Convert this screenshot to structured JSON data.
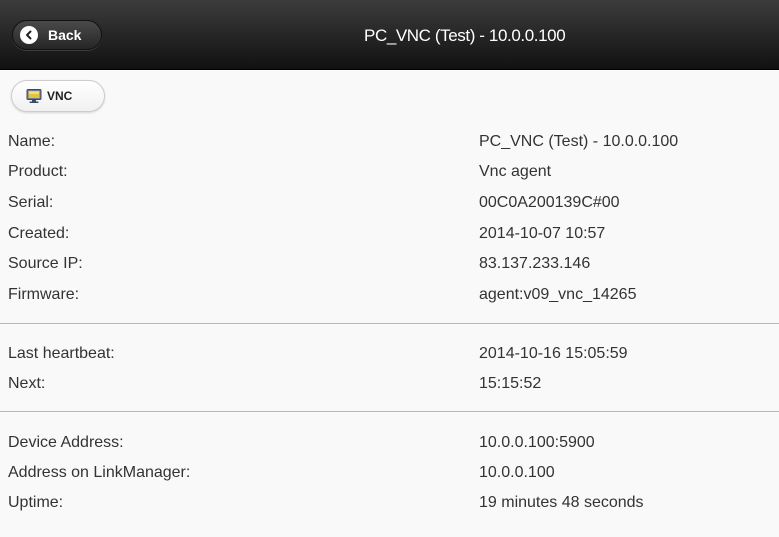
{
  "header": {
    "back_label": "Back",
    "title": "PC_VNC (Test) - 10.0.0.100"
  },
  "toolbar": {
    "vnc_label": "VNC"
  },
  "colors": {
    "header_bg": "#1f1f1f",
    "page_bg": "#f9f9f9",
    "text": "#333333"
  },
  "details": {
    "device": [
      {
        "label": "Name:",
        "value": "PC_VNC (Test) - 10.0.0.100"
      },
      {
        "label": "Product:",
        "value": "Vnc agent"
      },
      {
        "label": "Serial:",
        "value": "00C0A200139C#00"
      },
      {
        "label": "Created:",
        "value": "2014-10-07 10:57"
      },
      {
        "label": "Source IP:",
        "value": "83.137.233.146"
      },
      {
        "label": "Firmware:",
        "value": "agent:v09_vnc_14265"
      }
    ],
    "heartbeat": [
      {
        "label": "Last heartbeat:",
        "value": "2014-10-16 15:05:59"
      },
      {
        "label": "Next:",
        "value": "15:15:52"
      }
    ],
    "connection": [
      {
        "label": "Device Address:",
        "value": "10.0.0.100:5900"
      },
      {
        "label": "Address on LinkManager:",
        "value": "10.0.0.100"
      },
      {
        "label": "Uptime:",
        "value": "19 minutes 48 seconds"
      }
    ]
  }
}
